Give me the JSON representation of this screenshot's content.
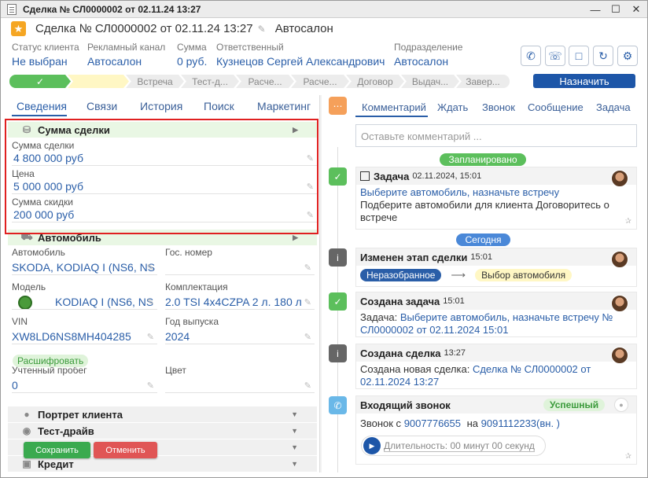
{
  "window": {
    "title": "Сделка № СЛ0000002 от 02.11.24 13:27"
  },
  "header": {
    "title": "Сделка № СЛ0000002 от 02.11.24 13:27",
    "org": "Автосалон"
  },
  "info": [
    {
      "label": "Статус клиента",
      "value": "Не выбран"
    },
    {
      "label": "Рекламный канал",
      "value": "Автосалон"
    },
    {
      "label": "Сумма",
      "value": "0 руб."
    },
    {
      "label": "Ответственный",
      "value": "Кузнецов Сергей Александрович"
    },
    {
      "label": "Подразделение",
      "value": "Автосалон"
    }
  ],
  "stages": [
    "✓",
    "",
    "Встреча",
    "Тест-д...",
    "Расче...",
    "Расче...",
    "Договор",
    "Выдач...",
    "Завер..."
  ],
  "assign_label": "Назначить",
  "left_tabs": [
    "Сведения",
    "Связи",
    "История",
    "Поиск",
    "Маркетинг"
  ],
  "deal_sum": {
    "title": "Сумма сделки",
    "fields": [
      {
        "label": "Сумма сделки",
        "value": "4 800 000 руб"
      },
      {
        "label": "Цена",
        "value": "5 000 000 руб"
      },
      {
        "label": "Сумма скидки",
        "value": "200 000 руб"
      }
    ]
  },
  "car": {
    "title": "Автомобиль",
    "auto_label": "Автомобиль",
    "auto_value": "SKODA, KODIAQ I (NS6, NS",
    "plate_label": "Гос. номер",
    "plate_value": "",
    "model_label": "Модель",
    "model_value": "KODIAQ I (NS6, NS",
    "equip_label": "Комплектация",
    "equip_value": "2.0 TSI 4x4CZPA 2 л. 180 л",
    "vin_label": "VIN",
    "vin_value": "XW8LD6NS8MH404285",
    "year_label": "Год выпуска",
    "year_value": "2024",
    "decode_label": "Расшифровать",
    "mileage_label": "Учтенный пробег",
    "mileage_value": "0",
    "color_label": "Цвет",
    "color_value": ""
  },
  "sections": [
    "Портрет клиента",
    "Тест-драйв",
    "",
    "Кредит"
  ],
  "buttons": {
    "save": "Сохранить",
    "cancel": "Отменить"
  },
  "right_tabs": [
    "Комментарий",
    "Ждать",
    "Звонок",
    "Сообщение",
    "Задача"
  ],
  "comment_placeholder": "Оставьте комментарий ...",
  "timeline": {
    "planned_label": "Запланировано",
    "today_label": "Сегодня",
    "task": {
      "title": "Задача",
      "time": "02.11.2024, 15:01",
      "link": "Выберите автомобиль, назначьте встречу",
      "text": "Подберите автомобили для клиента Договоритесь о встрече"
    },
    "stage_change": {
      "title": "Изменен этап сделки",
      "time": "15:01",
      "from": "Неразобранное",
      "to": "Выбор автомобиля"
    },
    "task_created": {
      "title": "Создана задача",
      "time": "15:01",
      "prefix": "Задача:",
      "link": "Выберите автомобиль, назначьте встречу № СЛ0000002 от 02.11.2024 15:01"
    },
    "deal_created": {
      "title": "Создана сделка",
      "time": "13:27",
      "prefix": "Создана новая сделка:",
      "link": "Сделка № СЛ0000002 от 02.11.2024 13:27"
    },
    "call": {
      "title": "Входящий звонок",
      "status": "Успешный",
      "from_label": "Звонок с",
      "from": "9007776655",
      "to_label": "на",
      "to": "9091112233(вн. )",
      "duration": "Длительность: 00 минут 00 секунд"
    }
  },
  "colors": {
    "accent": "#2a5ea8",
    "green": "#5cbf5c",
    "save": "#3aaa4f",
    "cancel": "#e05555",
    "highlight": "#e02020"
  }
}
